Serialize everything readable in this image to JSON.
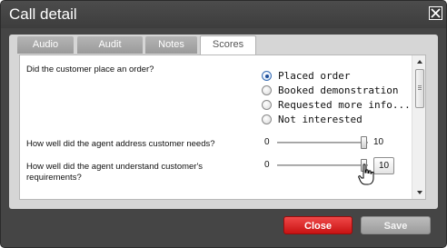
{
  "dialog": {
    "title": "Call detail"
  },
  "tabs": [
    {
      "label": "Audio"
    },
    {
      "label": "Audit"
    },
    {
      "label": "Notes"
    },
    {
      "label": "Scores",
      "active": true
    }
  ],
  "questions": {
    "order": {
      "text": "Did the customer place an order?",
      "options": [
        "Placed order",
        "Booked demonstration",
        "Requested more info...",
        "Not interested"
      ],
      "selected": "Placed order"
    },
    "needs": {
      "text": "How well did the agent address customer needs?",
      "min": "0",
      "max": "10",
      "value": 10
    },
    "understand": {
      "text_line1": "How well did the agent understand customer's",
      "text_line2": "requirements?",
      "min": "0",
      "value_label": "10",
      "value": 10
    }
  },
  "buttons": {
    "close": "Close",
    "save": "Save"
  },
  "colors": {
    "close_button": "#dc2020",
    "save_button": "#aaaaaa",
    "dialog_background": "#454545"
  }
}
